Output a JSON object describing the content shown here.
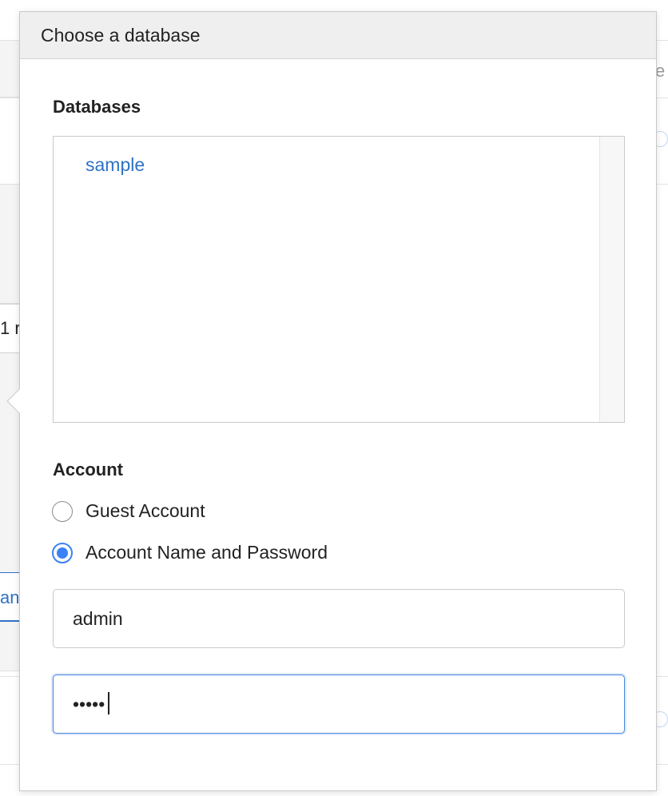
{
  "background": {
    "fragments": [
      "e",
      "1 r",
      "an"
    ]
  },
  "popover": {
    "title": "Choose a database",
    "databases_label": "Databases",
    "databases": [
      "sample"
    ],
    "account_label": "Account",
    "account_options": [
      {
        "label": "Guest Account",
        "checked": false
      },
      {
        "label": "Account Name and Password",
        "checked": true
      }
    ],
    "username_value": "admin",
    "password_value": "•••••"
  },
  "colors": {
    "accent": "#3b82f6",
    "link": "#2f72c4",
    "header_bg": "#efefef"
  }
}
